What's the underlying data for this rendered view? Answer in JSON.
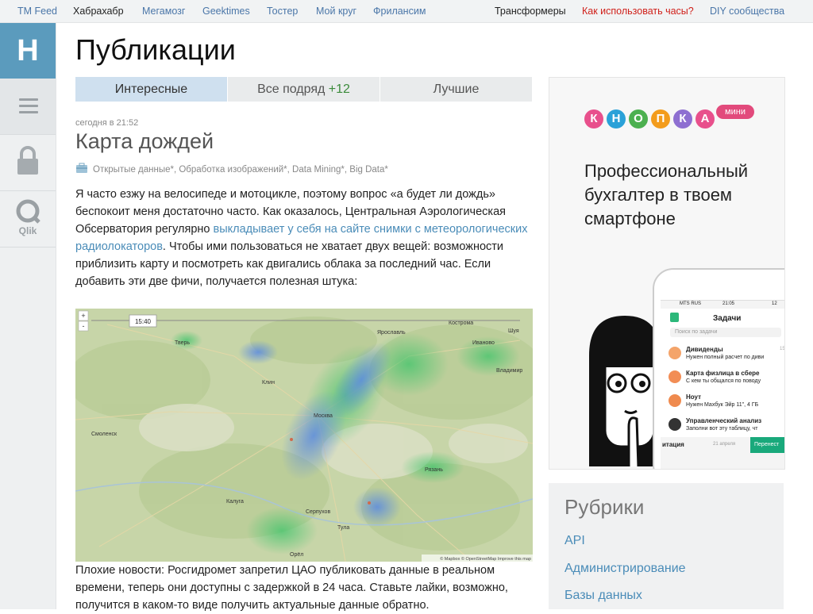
{
  "topnav": {
    "items": [
      "TM Feed",
      "Хабрахабр",
      "Мегамозг",
      "Geektimes",
      "Тостер",
      "Мой круг",
      "Фрилансим"
    ],
    "right": [
      "Трансформеры",
      "Как использовать часы?",
      "DIY сообщества"
    ]
  },
  "sidebar": {
    "logo": "H",
    "qlik": "Qlik"
  },
  "page": {
    "title": "Публикации"
  },
  "tabs": [
    {
      "label": "Интересные"
    },
    {
      "label": "Все подряд",
      "count": "+12"
    },
    {
      "label": "Лучшие"
    }
  ],
  "post": {
    "time": "сегодня в 21:52",
    "title": "Карта дождей",
    "hubs": "Открытые данные*, Обработка изображений*, Data Mining*, Big Data*",
    "p1_a": "Я часто езжу на велосипеде и мотоцикле, поэтому вопрос «а будет ли дождь» беспокоит меня достаточно часто. Как оказалось, Центральная Аэрологическая Обсерватория регулярно ",
    "p1_link": "выкладывает у себя на сайте снимки с метеорологических радиолокаторов",
    "p1_b": ". Чтобы ими пользоваться не хватает двух вещей: возможности приблизить карту и посмотреть как двигались облака за последний час. Если добавить эти две фичи, получается полезная штука:",
    "p2": "Плохие новости: Росгидромет запретил ЦАО публиковать данные в реальном времени, теперь они доступны с задержкой в 24 часа. Ставьте лайки, возможно, получится в каком-то виде получить актуальные данные обратно."
  },
  "map": {
    "time": "15:40",
    "zoom_in": "+",
    "zoom_out": "-",
    "credit": "© Mapbox © OpenStreetMap Improve this map",
    "cities": [
      "Москва",
      "Тверь",
      "Ярославль",
      "Владимир",
      "Рязань",
      "Тула",
      "Калуга",
      "Смоленск",
      "Кострома",
      "Иваново",
      "Серпухов",
      "Орёл",
      "Клин",
      "Шуя"
    ]
  },
  "ad": {
    "brand_letters": [
      "К",
      "Н",
      "О",
      "П",
      "К",
      "А"
    ],
    "brand_colors": [
      "#e8508c",
      "#2aa1d8",
      "#4cb050",
      "#f39c1c",
      "#8e6fd1",
      "#e8508c"
    ],
    "badge": "мини",
    "text": "Профессиональный бухгалтер в твоем смартфоне",
    "phone": {
      "status": "MTS RUS",
      "clock": "21:05",
      "battery": "12",
      "title": "Задачи",
      "search": "Поиск по задачи",
      "tasks": [
        {
          "title": "Дивиденды",
          "sub": "Нужен полный расчет по диви",
          "date": "15"
        },
        {
          "title": "Карта физлица в сбере",
          "sub": "С кем ты общался по поводу",
          "date": ""
        },
        {
          "title": "Ноут",
          "sub": "Нужен Махбук Эйр 11\", 4 ГБ",
          "date": ""
        },
        {
          "title": "Управленческий анализ",
          "sub": "Заполни вот эту таблицу, чт",
          "date": ""
        }
      ],
      "footer_left": "итация",
      "footer_date": "21 апреля",
      "footer_btn": "Перенест"
    }
  },
  "rubriki": {
    "title": "Рубрики",
    "items": [
      "API",
      "Администрирование",
      "Базы данных"
    ]
  },
  "colors": {
    "accent": "#4a76a8",
    "tab_active": "#cfe0ef",
    "logo": "#5b9bbd",
    "count": "#3b8b3b"
  }
}
